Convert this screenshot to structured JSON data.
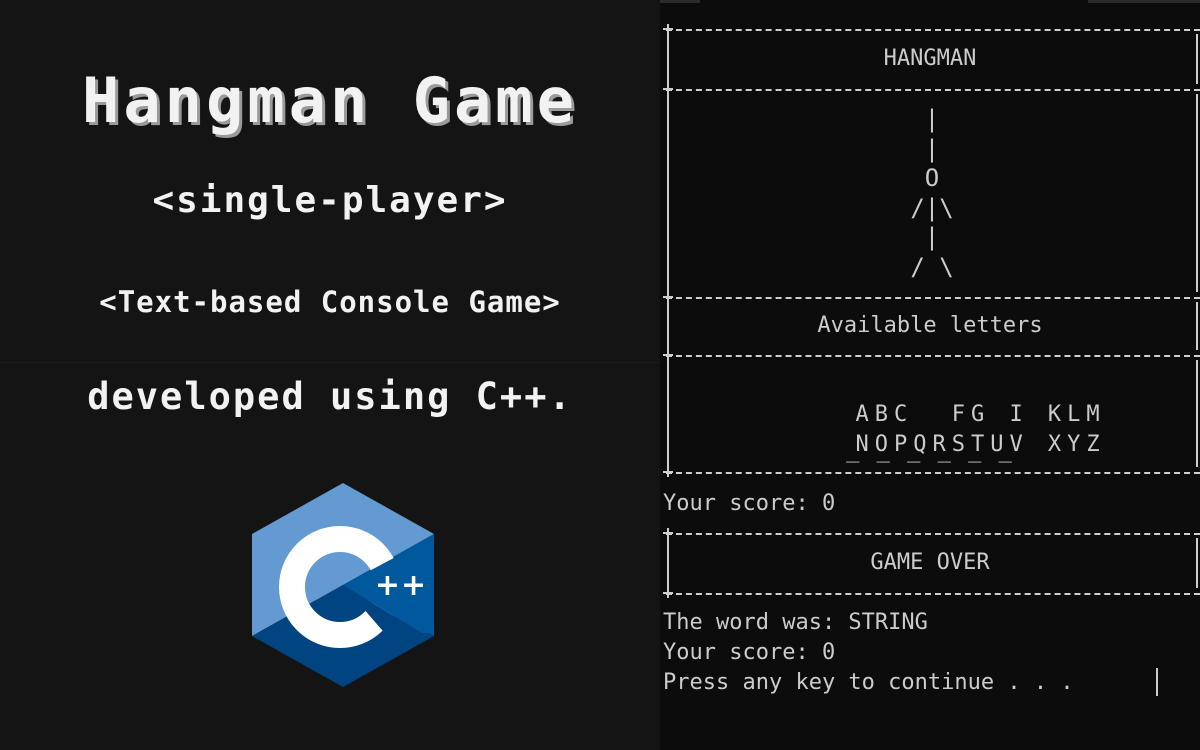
{
  "promo": {
    "title": "Hangman Game",
    "subtitle": "<single-player>",
    "type": "<Text-based Console Game>",
    "developed": "developed using C++.",
    "logo_text": "C",
    "logo_plus": "++",
    "logo_icon": "cpp-logo-icon",
    "colors": {
      "logo_light": "#649ad2",
      "logo_mid": "#00599c",
      "logo_dark": "#004482"
    }
  },
  "console": {
    "header": "HANGMAN",
    "gallows": [
      "|",
      "|",
      "O",
      "/|\\",
      "|",
      "/ \\"
    ],
    "letters_title": "Available letters",
    "letters_row1": "ABC  FG I KLM",
    "letters_row2": "NOPQRSTUV XYZ",
    "word_blanks": "_ _ _ _ _ _",
    "score_line": "Your score: 0",
    "game_over": "GAME OVER",
    "word_line": "The word was: STRING",
    "score_line2": "Your score: 0",
    "prompt": "Press any key to continue . . ."
  }
}
